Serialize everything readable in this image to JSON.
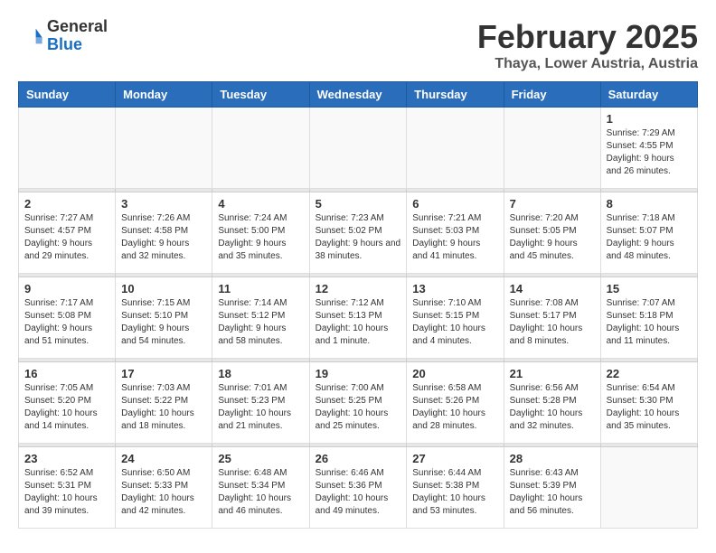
{
  "logo": {
    "general": "General",
    "blue": "Blue"
  },
  "header": {
    "title": "February 2025",
    "subtitle": "Thaya, Lower Austria, Austria"
  },
  "days_of_week": [
    "Sunday",
    "Monday",
    "Tuesday",
    "Wednesday",
    "Thursday",
    "Friday",
    "Saturday"
  ],
  "weeks": [
    [
      {
        "day": "",
        "info": ""
      },
      {
        "day": "",
        "info": ""
      },
      {
        "day": "",
        "info": ""
      },
      {
        "day": "",
        "info": ""
      },
      {
        "day": "",
        "info": ""
      },
      {
        "day": "",
        "info": ""
      },
      {
        "day": "1",
        "info": "Sunrise: 7:29 AM\nSunset: 4:55 PM\nDaylight: 9 hours and 26 minutes."
      }
    ],
    [
      {
        "day": "2",
        "info": "Sunrise: 7:27 AM\nSunset: 4:57 PM\nDaylight: 9 hours and 29 minutes."
      },
      {
        "day": "3",
        "info": "Sunrise: 7:26 AM\nSunset: 4:58 PM\nDaylight: 9 hours and 32 minutes."
      },
      {
        "day": "4",
        "info": "Sunrise: 7:24 AM\nSunset: 5:00 PM\nDaylight: 9 hours and 35 minutes."
      },
      {
        "day": "5",
        "info": "Sunrise: 7:23 AM\nSunset: 5:02 PM\nDaylight: 9 hours and 38 minutes."
      },
      {
        "day": "6",
        "info": "Sunrise: 7:21 AM\nSunset: 5:03 PM\nDaylight: 9 hours and 41 minutes."
      },
      {
        "day": "7",
        "info": "Sunrise: 7:20 AM\nSunset: 5:05 PM\nDaylight: 9 hours and 45 minutes."
      },
      {
        "day": "8",
        "info": "Sunrise: 7:18 AM\nSunset: 5:07 PM\nDaylight: 9 hours and 48 minutes."
      }
    ],
    [
      {
        "day": "9",
        "info": "Sunrise: 7:17 AM\nSunset: 5:08 PM\nDaylight: 9 hours and 51 minutes."
      },
      {
        "day": "10",
        "info": "Sunrise: 7:15 AM\nSunset: 5:10 PM\nDaylight: 9 hours and 54 minutes."
      },
      {
        "day": "11",
        "info": "Sunrise: 7:14 AM\nSunset: 5:12 PM\nDaylight: 9 hours and 58 minutes."
      },
      {
        "day": "12",
        "info": "Sunrise: 7:12 AM\nSunset: 5:13 PM\nDaylight: 10 hours and 1 minute."
      },
      {
        "day": "13",
        "info": "Sunrise: 7:10 AM\nSunset: 5:15 PM\nDaylight: 10 hours and 4 minutes."
      },
      {
        "day": "14",
        "info": "Sunrise: 7:08 AM\nSunset: 5:17 PM\nDaylight: 10 hours and 8 minutes."
      },
      {
        "day": "15",
        "info": "Sunrise: 7:07 AM\nSunset: 5:18 PM\nDaylight: 10 hours and 11 minutes."
      }
    ],
    [
      {
        "day": "16",
        "info": "Sunrise: 7:05 AM\nSunset: 5:20 PM\nDaylight: 10 hours and 14 minutes."
      },
      {
        "day": "17",
        "info": "Sunrise: 7:03 AM\nSunset: 5:22 PM\nDaylight: 10 hours and 18 minutes."
      },
      {
        "day": "18",
        "info": "Sunrise: 7:01 AM\nSunset: 5:23 PM\nDaylight: 10 hours and 21 minutes."
      },
      {
        "day": "19",
        "info": "Sunrise: 7:00 AM\nSunset: 5:25 PM\nDaylight: 10 hours and 25 minutes."
      },
      {
        "day": "20",
        "info": "Sunrise: 6:58 AM\nSunset: 5:26 PM\nDaylight: 10 hours and 28 minutes."
      },
      {
        "day": "21",
        "info": "Sunrise: 6:56 AM\nSunset: 5:28 PM\nDaylight: 10 hours and 32 minutes."
      },
      {
        "day": "22",
        "info": "Sunrise: 6:54 AM\nSunset: 5:30 PM\nDaylight: 10 hours and 35 minutes."
      }
    ],
    [
      {
        "day": "23",
        "info": "Sunrise: 6:52 AM\nSunset: 5:31 PM\nDaylight: 10 hours and 39 minutes."
      },
      {
        "day": "24",
        "info": "Sunrise: 6:50 AM\nSunset: 5:33 PM\nDaylight: 10 hours and 42 minutes."
      },
      {
        "day": "25",
        "info": "Sunrise: 6:48 AM\nSunset: 5:34 PM\nDaylight: 10 hours and 46 minutes."
      },
      {
        "day": "26",
        "info": "Sunrise: 6:46 AM\nSunset: 5:36 PM\nDaylight: 10 hours and 49 minutes."
      },
      {
        "day": "27",
        "info": "Sunrise: 6:44 AM\nSunset: 5:38 PM\nDaylight: 10 hours and 53 minutes."
      },
      {
        "day": "28",
        "info": "Sunrise: 6:43 AM\nSunset: 5:39 PM\nDaylight: 10 hours and 56 minutes."
      },
      {
        "day": "",
        "info": ""
      }
    ]
  ]
}
